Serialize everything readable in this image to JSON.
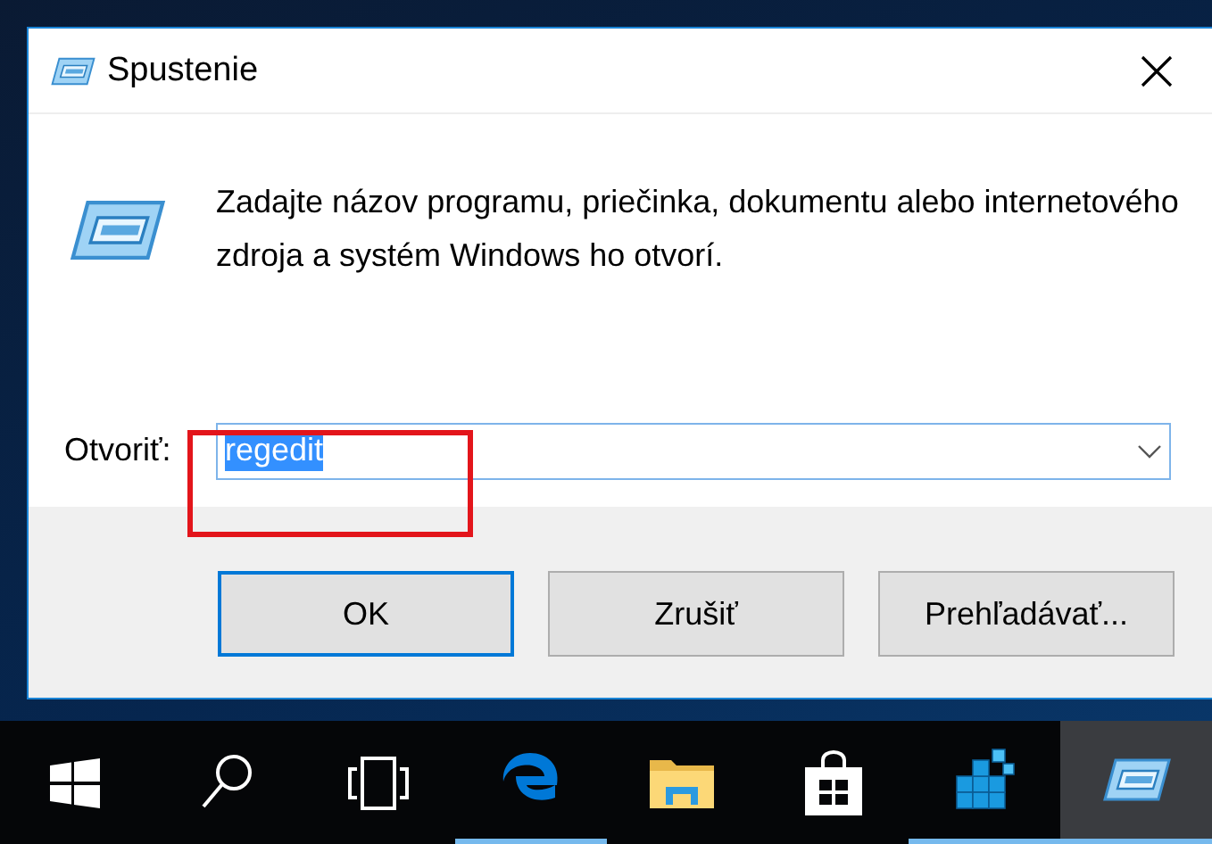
{
  "window": {
    "title": "Spustenie"
  },
  "description": "Zadajte názov programu, priečinka, dokumentu alebo internetového zdroja a systém Windows ho otvorí.",
  "open_field": {
    "label": "Otvoriť:",
    "value": "regedit",
    "selected": true,
    "highlighted": true
  },
  "buttons": [
    {
      "label": "OK",
      "default": true
    },
    {
      "label": "Zrušiť",
      "default": false
    },
    {
      "label": "Prehľadávať...",
      "default": false
    }
  ],
  "taskbar": [
    {
      "kind": "start",
      "running": false,
      "active": false
    },
    {
      "kind": "search",
      "running": false,
      "active": false
    },
    {
      "kind": "taskview",
      "running": false,
      "active": false
    },
    {
      "kind": "browser",
      "running": true,
      "active": false
    },
    {
      "kind": "folder",
      "running": false,
      "active": false
    },
    {
      "kind": "store",
      "running": false,
      "active": false
    },
    {
      "kind": "registry",
      "running": true,
      "active": false
    },
    {
      "kind": "run",
      "running": true,
      "active": true
    }
  ]
}
